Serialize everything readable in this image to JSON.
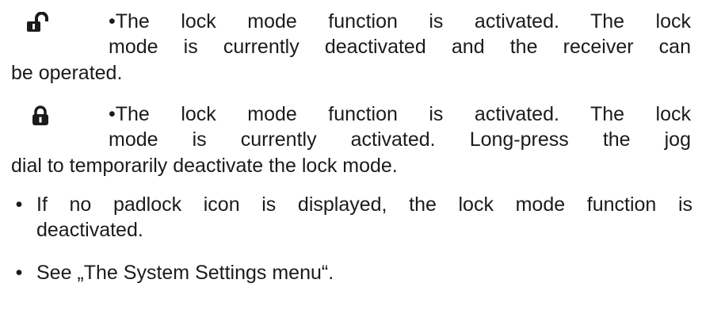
{
  "icons": {
    "unlocked": "padlock-open-icon",
    "locked": "padlock-closed-icon"
  },
  "colors": {
    "text": "#1b1b1b",
    "background": "#ffffff"
  },
  "paragraph_unlocked": {
    "line1": "•The lock mode function is activated. The lock",
    "line2": "mode is currently deactivated and the receiver can",
    "line3": "be operated."
  },
  "paragraph_locked": {
    "line1": "•The lock mode function is activated. The lock",
    "line2": "mode is currently activated. Long-press the jog",
    "line3": "dial to temporarily deactivate the lock mode."
  },
  "bullet_marker": "•",
  "bullets": [
    {
      "line1": "If no padlock icon is displayed, the lock mode function is",
      "line2": "deactivated."
    },
    {
      "line1": "See „The System Settings menu“."
    }
  ]
}
